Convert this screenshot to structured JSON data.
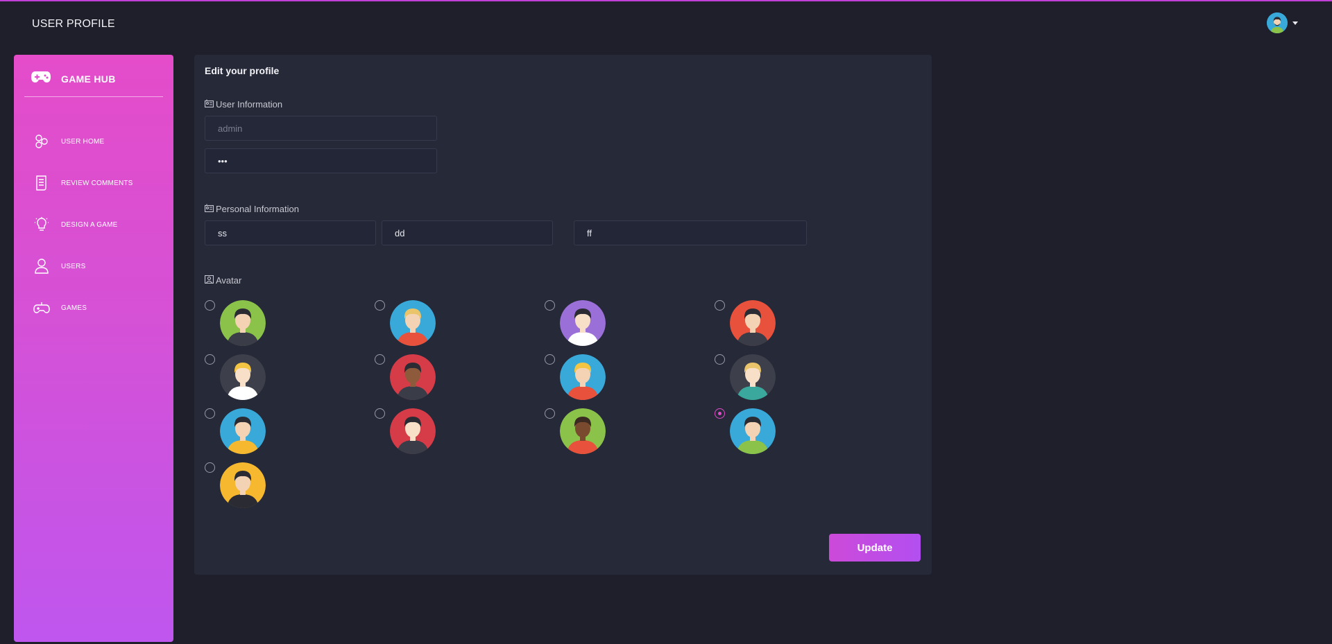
{
  "header": {
    "title": "USER PROFILE"
  },
  "brand": {
    "name": "GAME HUB"
  },
  "sidebar": {
    "items": [
      {
        "label": "USER HOME",
        "icon": "home-hexagon-icon"
      },
      {
        "label": "REVIEW COMMENTS",
        "icon": "document-icon"
      },
      {
        "label": "DESIGN A GAME",
        "icon": "lightbulb-icon"
      },
      {
        "label": "USERS",
        "icon": "user-icon"
      },
      {
        "label": "GAMES",
        "icon": "gamepad-icon"
      }
    ]
  },
  "form": {
    "title": "Edit your profile",
    "user_info_label": "User Information",
    "username_placeholder": "admin",
    "password_value": "•••",
    "personal_info_label": "Personal Information",
    "first_value": "ss",
    "second_value": "dd",
    "third_value": "ff",
    "avatar_label": "Avatar",
    "selected_avatar": 12,
    "avatars": [
      {
        "id": 1,
        "bg": "#8bc34a"
      },
      {
        "id": 2,
        "bg": "#38a9d9"
      },
      {
        "id": 3,
        "bg": "#9b6fd8"
      },
      {
        "id": 4,
        "bg": "#e8513b"
      },
      {
        "id": 5,
        "bg": "#3d3f4a"
      },
      {
        "id": 6,
        "bg": "#d63c48"
      },
      {
        "id": 7,
        "bg": "#38a9d9"
      },
      {
        "id": 8,
        "bg": "#3d3f4a"
      },
      {
        "id": 9,
        "bg": "#38a9d9"
      },
      {
        "id": 10,
        "bg": "#d63c48"
      },
      {
        "id": 11,
        "bg": "#8bc34a"
      },
      {
        "id": 12,
        "bg": "#38a9d9"
      },
      {
        "id": 13,
        "bg": "#f5b82e"
      }
    ],
    "update_label": "Update"
  },
  "colors": {
    "accent": "#d94ed3",
    "background": "#1f1f2b",
    "card": "#262938"
  }
}
